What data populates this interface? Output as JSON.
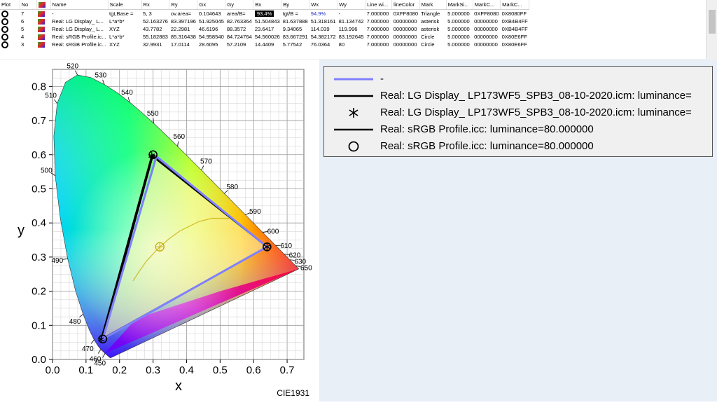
{
  "table": {
    "columns": [
      "Plot",
      "No",
      "",
      "Name",
      "Scale",
      "Rx",
      "Ry",
      "Gx",
      "Gy",
      "Bx",
      "By",
      "Wx",
      "Wy",
      "Line wi...",
      "lineColor",
      "Mark",
      "MarkSi...",
      "MarkC...",
      "MarkC..."
    ],
    "rows": [
      {
        "no": "7",
        "name": "-",
        "scale": "tgt,Base =",
        "rx": "5, 3",
        "ry": "ov.area=",
        "gx": "0.104643",
        "gy": "area/B=",
        "bx": "93.4%",
        "by": "tgt/B =",
        "wx": "94.9%",
        "wy": "-",
        "linew": "7.000000",
        "linecolor": "0XFF8080",
        "mark": "Triangle",
        "marksize": "5.000000",
        "markc1": "0XFF8080",
        "markc2": "0X8080FF"
      },
      {
        "no": "6",
        "name": "Real: LG Display_  L...",
        "scale": "L*a*b*",
        "rx": "52.163276",
        "ry": "83.397196",
        "gx": "51.925045",
        "gy": "82.763364",
        "bx": "51.504843",
        "by": "81.637888",
        "wx": "51.318161",
        "wy": "81.134742",
        "linew": "7.000000",
        "linecolor": "00000000",
        "mark": "asterisk",
        "marksize": "5.000000",
        "markc1": "00000000",
        "markc2": "0XB4B4FF"
      },
      {
        "no": "5",
        "name": "Real: LG Display_  L...",
        "scale": "XYZ",
        "rx": "43.7782",
        "ry": "22.2981",
        "gx": "46.6196",
        "gy": "88.3572",
        "bx": "23.6417",
        "by": "9.34065",
        "wx": "114.039",
        "wy": "119.996",
        "linew": "7.000000",
        "linecolor": "00000000",
        "mark": "asterisk",
        "marksize": "5.000000",
        "markc1": "00000000",
        "markc2": "0XB4B4FF"
      },
      {
        "no": "4",
        "name": "Real: sRGB Profile.ic...",
        "scale": "L*a*b*",
        "rx": "55.182883",
        "ry": "85.316438",
        "gx": "54.958540",
        "gy": "84.724764",
        "bx": "54.560026",
        "by": "83.667291",
        "wx": "54.382172",
        "wy": "83.192645",
        "linew": "7.000000",
        "linecolor": "00000000",
        "mark": "Circle",
        "marksize": "5.000000",
        "markc1": "00000000",
        "markc2": "0X80E6FF"
      },
      {
        "no": "3",
        "name": "Real: sRGB Profile.ic...",
        "scale": "XYZ",
        "rx": "32.9931",
        "ry": "17.0114",
        "gx": "28.6095",
        "gy": "57.2109",
        "bx": "14.4409",
        "by": "5.77542",
        "wx": "76.0364",
        "wy": "80",
        "linew": "7.000000",
        "linecolor": "00000000",
        "mark": "Circle",
        "marksize": "5.000000",
        "markc1": "00000000",
        "markc2": "0X80E6FF"
      }
    ]
  },
  "chart_data": {
    "type": "scatter",
    "title": "",
    "footer": "CIE1931",
    "xlabel": "x",
    "ylabel": "y",
    "xlim": [
      0.0,
      0.75
    ],
    "ylim": [
      0.0,
      0.85
    ],
    "x_ticks": [
      "0.0",
      "0.1",
      "0.2",
      "0.3",
      "0.4",
      "0.5",
      "0.6",
      "0.7"
    ],
    "y_ticks": [
      "0.0",
      "0.1",
      "0.2",
      "0.3",
      "0.4",
      "0.5",
      "0.6",
      "0.7",
      "0.8"
    ],
    "grid": true,
    "wavelength_labels": [
      "450",
      "460",
      "470",
      "480",
      "490",
      "500",
      "510",
      "520",
      "530",
      "540",
      "550",
      "560",
      "570",
      "580",
      "590",
      "600",
      "610",
      "620",
      "630",
      "650"
    ],
    "series": [
      {
        "name": "-",
        "color": "#8080FF",
        "points": [
          [
            0.64,
            0.33
          ],
          [
            0.31,
            0.595
          ],
          [
            0.15,
            0.06
          ]
        ]
      },
      {
        "name": "Real: LG Display_  LP173WF5_SPB3_08-10-2020.icm: luminance=",
        "color": "#000000",
        "mark": "asterisk",
        "points": [
          [
            0.64,
            0.33
          ],
          [
            0.296,
            0.597
          ],
          [
            0.145,
            0.059
          ]
        ],
        "whitepoint": [
          0.3127,
          0.329
        ]
      },
      {
        "name": "Real: sRGB Profile.icc: luminance=80.000000",
        "color": "#000000",
        "mark": "circle",
        "points": [
          [
            0.64,
            0.33
          ],
          [
            0.3,
            0.6
          ],
          [
            0.15,
            0.06
          ]
        ]
      }
    ],
    "legend_placement": "right",
    "legend_entries": [
      {
        "label": "-",
        "sample": "line",
        "color": "#8080FF"
      },
      {
        "label": "Real: LG Display_  LP173WF5_SPB3_08-10-2020.icm: luminance=",
        "sample": "line",
        "color": "#000000"
      },
      {
        "label": "Real: LG Display_  LP173WF5_SPB3_08-10-2020.icm: luminance=",
        "sample": "asterisk",
        "color": "#000000"
      },
      {
        "label": "Real: sRGB Profile.icc: luminance=80.000000",
        "sample": "line",
        "color": "#000000"
      },
      {
        "label": "Real: sRGB Profile.icc: luminance=80.000000",
        "sample": "circle",
        "color": "#000000"
      }
    ]
  },
  "colors": {
    "accent_blue": "#8080FF",
    "panel_bg": "#E8EFF7",
    "legend_bg": "#F0F0F0",
    "highlight": "#000000"
  }
}
